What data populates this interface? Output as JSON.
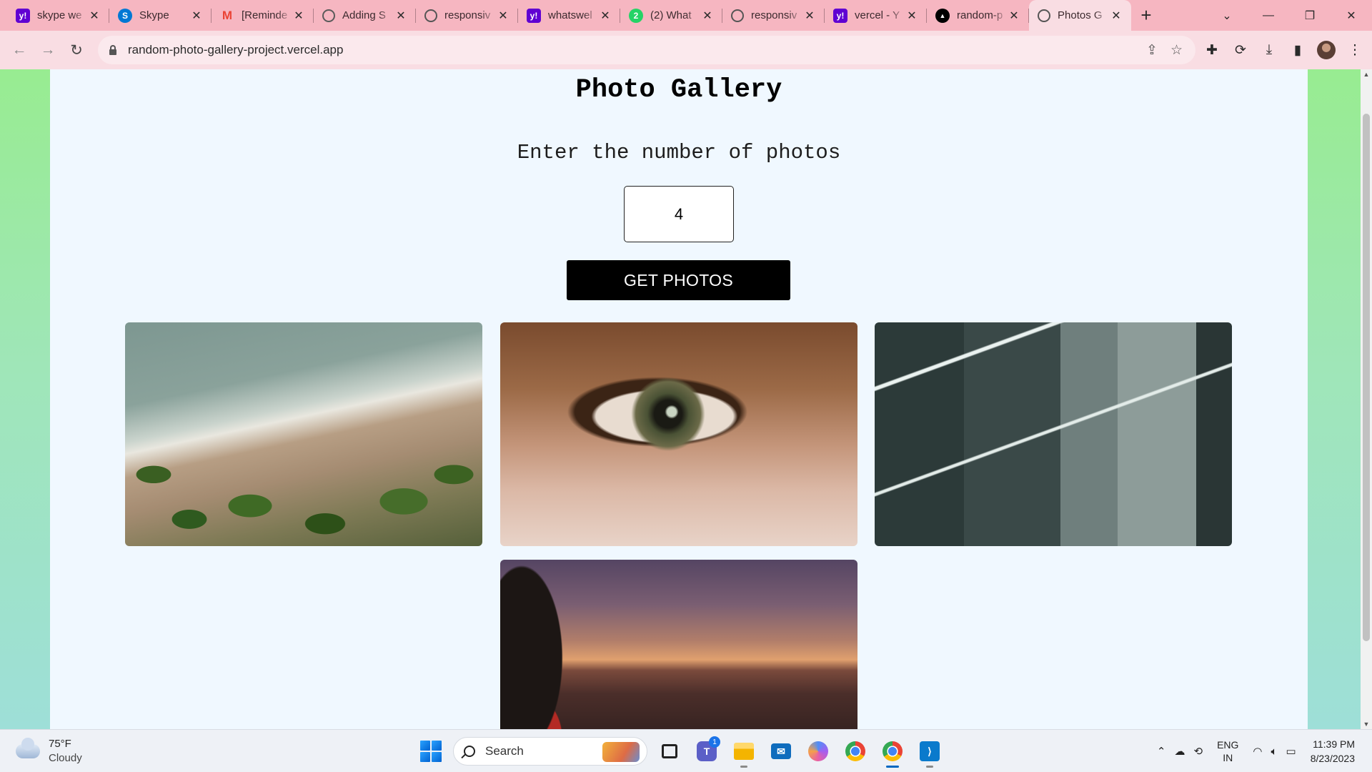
{
  "browser": {
    "tabs": [
      {
        "label": "skype we",
        "favicon": "yahoo-favicon",
        "fav_text": "y!"
      },
      {
        "label": "Skype",
        "favicon": "skype-favicon",
        "fav_text": "S"
      },
      {
        "label": "[Reminde",
        "favicon": "gmail-favicon",
        "fav_text": "M"
      },
      {
        "label": "Adding S",
        "favicon": "chatgpt-favicon",
        "fav_text": ""
      },
      {
        "label": "responsiv",
        "favicon": "globe-favicon",
        "fav_text": ""
      },
      {
        "label": "whatswel",
        "favicon": "yahoo-favicon",
        "fav_text": "y!"
      },
      {
        "label": "(2) What",
        "favicon": "whatsapp-favicon",
        "fav_text": "2"
      },
      {
        "label": "responsiv",
        "favicon": "globe-favicon",
        "fav_text": ""
      },
      {
        "label": "vercel - Y",
        "favicon": "yahoo-favicon",
        "fav_text": "y!"
      },
      {
        "label": "random-p",
        "favicon": "vercel-favicon",
        "fav_text": "▲"
      },
      {
        "label": "Photos G",
        "favicon": "globe-favicon",
        "fav_text": "",
        "active": true
      }
    ],
    "new_tab_glyph": "+",
    "url": "random-photo-gallery-project.vercel.app",
    "colors": {
      "tabstrip": "#f6b6c1",
      "toolbar": "#f9dde3"
    }
  },
  "page": {
    "title": "Photo Gallery",
    "prompt": "Enter the number of photos",
    "count_value": "4",
    "button_label": "GET PHOTOS",
    "photos": [
      {
        "name": "beach-aerial-photo"
      },
      {
        "name": "eye-closeup-photo"
      },
      {
        "name": "architecture-lights-photo"
      },
      {
        "name": "desert-sunset-photo"
      }
    ],
    "colors": {
      "background": "#f0f8ff",
      "button": "#000000",
      "body_gradient": [
        "#98ec91",
        "#9edfd8"
      ]
    }
  },
  "taskbar": {
    "weather_temp": "75°F",
    "weather_desc": "Cloudy",
    "search_label": "Search",
    "teams_badge": "1",
    "lang_line1": "ENG",
    "lang_line2": "IN",
    "time": "11:39 PM",
    "date": "8/23/2023"
  }
}
